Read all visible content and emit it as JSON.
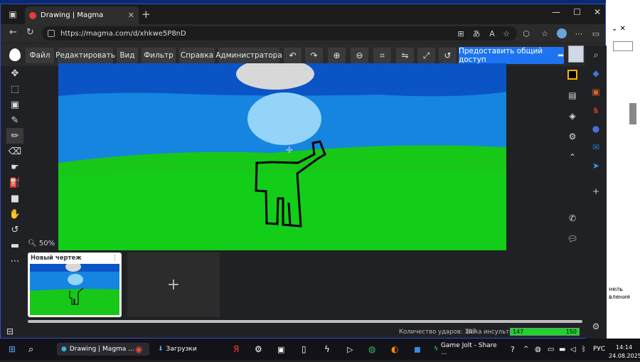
{
  "browser": {
    "tab_title": "Drawing | Magma",
    "tab_close": "✕",
    "new_tab": "+",
    "url": "https://magma.com/d/xhkwe5P8nD",
    "minimize": "—",
    "maximize": "☐",
    "close": "✕"
  },
  "toolbar": {
    "menus": [
      "Файл",
      "Редактировать",
      "Вид",
      "Фильтр",
      "Справка",
      "Администратора"
    ],
    "share_label": "Предоставить общий доступ"
  },
  "canvas": {
    "zoom_label": "50%",
    "colors": {
      "sky_top": "#0a54c6",
      "sky": "#1585e0",
      "grass": "#17c818",
      "grass_light": "#0fd31c",
      "body": "#94d4f8",
      "head_top": "#d8d8d8",
      "outline": "#000000"
    }
  },
  "thumbnails": {
    "drawing_title": "Новый чертеж",
    "add_label": "+"
  },
  "status": {
    "strokes_label": "Количество ударов:",
    "strokes_value": "147",
    "stroke_weight_label": "Веха инсульта:",
    "meter_value": "147",
    "meter_max": "150",
    "meter_fraction": 0.98
  },
  "background_window": {
    "text_line1": "нель",
    "text_line2": "вления"
  },
  "taskbar": {
    "browser_item": "Drawing | Magma ...",
    "downloads_item": "Загрузки",
    "gamejolt_item": "Game Jolt - Share ...",
    "language": "РУС",
    "time": "14:14",
    "date": "24.08.2025"
  },
  "accent_colors": {
    "share_button": "#1e74f0",
    "meter_fill": "#1bd52a",
    "window_border": "#2b4fd6"
  }
}
